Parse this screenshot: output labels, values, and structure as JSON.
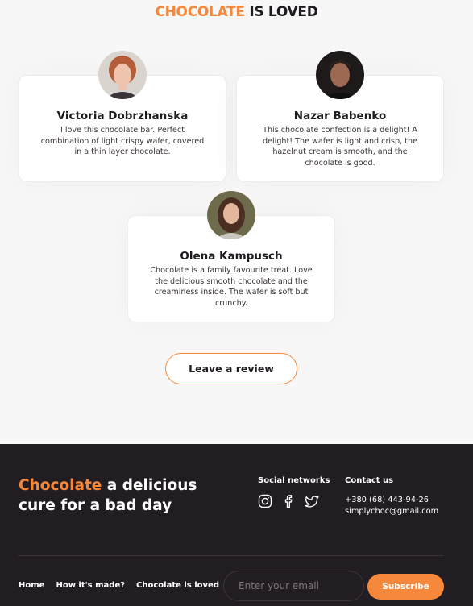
{
  "section": {
    "title_accent": "CHOCOLATE",
    "title_rest": " IS LOVED"
  },
  "reviews": [
    {
      "name": "Victoria Dobrzhanska",
      "text": "I love this chocolate bar. Perfect combination of light crispy wafer, covered in a thin layer chocolate."
    },
    {
      "name": "Nazar Babenko",
      "text": "This chocolate confection is a delight! A delight! The wafer is light and crisp, the hazelnut cream is smooth, and the chocolate is good."
    },
    {
      "name": "Olena Kampusch",
      "text": "Chocolate is a family favourite treat. Love the delicious smooth chocolate and the creaminess inside. The wafer is soft but crunchy."
    }
  ],
  "review_button": "Leave a review",
  "footer": {
    "slogan_accent": "Chocolate",
    "slogan_rest": " a delicious cure for a bad day",
    "social_title": "Social networks",
    "social_icons": [
      "instagram-icon",
      "facebook-icon",
      "twitter-icon"
    ],
    "contact_title": "Contact us",
    "phone": "+380 (68) 443-94-26",
    "email": "simplychoc@gmail.com",
    "nav": [
      "Home",
      "How it's made?",
      "Chocolate is loved"
    ],
    "email_placeholder": "Enter your email",
    "subscribe_label": "Subscribe"
  },
  "colors": {
    "accent": "#f5883a",
    "footer_bg": "#221d22",
    "page_bg": "#f7f7f7"
  }
}
